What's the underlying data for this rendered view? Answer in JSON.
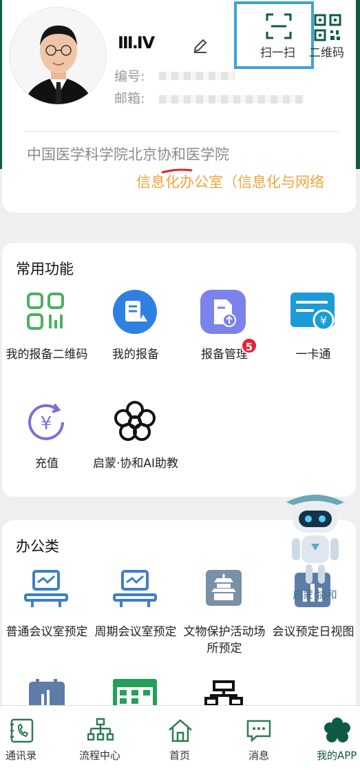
{
  "profile": {
    "name": "Ⅲ.Ⅳ",
    "id_label": "编号:",
    "email_label": "邮箱:",
    "organization": "中国医学科学院北京协和医学院",
    "department": "信息化办公室（信息化与网络",
    "scan_label": "扫一扫",
    "qrcode_label": "二维码",
    "colors": {
      "header_green": "#0f5a45",
      "dept_orange": "#f2a43a",
      "highlight_blue": "#3ea2d8"
    }
  },
  "common": {
    "title": "常用功能",
    "items": [
      {
        "label": "我的报备二维码",
        "icon": "qr-grid-icon"
      },
      {
        "label": "我的报备",
        "icon": "report-doc-icon"
      },
      {
        "label": "报备管理",
        "icon": "upload-doc-icon",
        "badge": "5"
      },
      {
        "label": "一卡通",
        "icon": "card-icon"
      },
      {
        "label": "充值",
        "icon": "yen-refresh-icon"
      },
      {
        "label": "启蒙·协和AI助教",
        "icon": "flower-icon"
      }
    ]
  },
  "office": {
    "title": "办公类",
    "items": [
      {
        "label": "普通会议室预定",
        "icon": "meeting-monitor-icon"
      },
      {
        "label": "周期会议室预定",
        "icon": "meeting-monitor-icon"
      },
      {
        "label": "文物保护活动场所预定",
        "icon": "temple-icon"
      },
      {
        "label": "会议预定日视图",
        "icon": "bar-chart-icon"
      }
    ]
  },
  "robot": {
    "text": "启蒙·协和"
  },
  "nav": [
    {
      "label": "通讯录",
      "icon": "phone-book-icon"
    },
    {
      "label": "流程中心",
      "icon": "org-tree-icon"
    },
    {
      "label": "首页",
      "icon": "home-icon"
    },
    {
      "label": "消息",
      "icon": "message-icon"
    },
    {
      "label": "我的APP",
      "icon": "gear-flower-icon"
    }
  ]
}
